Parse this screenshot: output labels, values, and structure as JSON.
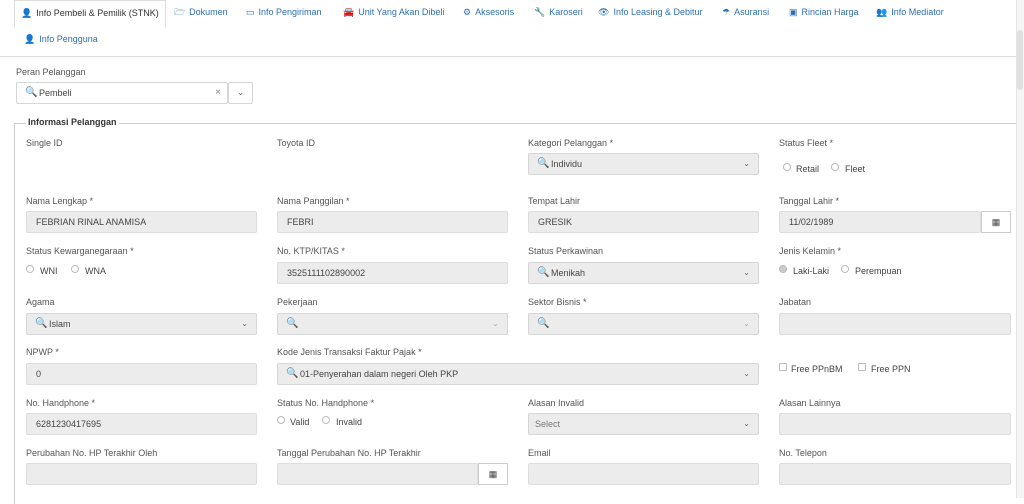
{
  "tabs": [
    {
      "label": "Info Pembeli & Pemilik (STNK)",
      "icon": "user-icon",
      "glyph": "👤"
    },
    {
      "label": "Dokumen",
      "icon": "folder-icon",
      "glyph": "🗁"
    },
    {
      "label": "Info Pengiriman",
      "icon": "map-icon",
      "glyph": "▭"
    },
    {
      "label": "Unit Yang Akan Dibeli",
      "icon": "car-icon",
      "glyph": "🚘"
    },
    {
      "label": "Aksesoris",
      "icon": "cogs-icon",
      "glyph": "⚙"
    },
    {
      "label": "Karoseri",
      "icon": "wrench-icon",
      "glyph": "🔧"
    },
    {
      "label": "Info Leasing & Debitur",
      "icon": "eye-icon",
      "glyph": "👁"
    },
    {
      "label": "Asuransi",
      "icon": "umbrella-icon",
      "glyph": "☂"
    },
    {
      "label": "Rincian Harga",
      "icon": "money-icon",
      "glyph": "▣"
    },
    {
      "label": "Info Mediator",
      "icon": "users-icon",
      "glyph": "👥"
    },
    {
      "label": "Info Pengguna",
      "icon": "user-icon",
      "glyph": "👤"
    }
  ],
  "peran": {
    "label": "Peran Pelanggan",
    "value": "Pembeli",
    "clear": "×",
    "chevron": "⌄"
  },
  "section_title": "Informasi Pelanggan",
  "fields": {
    "single_id": {
      "label": "Single ID"
    },
    "toyota_id": {
      "label": "Toyota ID"
    },
    "kategori": {
      "label": "Kategori Pelanggan *",
      "value": "Individu"
    },
    "status_fleet": {
      "label": "Status Fleet *",
      "opt1": "Retail",
      "opt2": "Fleet"
    },
    "nama_lengkap": {
      "label": "Nama Lengkap *",
      "value": "FEBRIAN RINAL ANAMISA"
    },
    "nama_panggilan": {
      "label": "Nama Panggilan *",
      "value": "FEBRI"
    },
    "tempat_lahir": {
      "label": "Tempat Lahir",
      "value": "GRESIK"
    },
    "tanggal_lahir": {
      "label": "Tanggal Lahir *",
      "value": "11/02/1989"
    },
    "kewarganegaraan": {
      "label": "Status Kewarganegaraan *",
      "opt1": "WNI",
      "opt2": "WNA"
    },
    "ktp": {
      "label": "No. KTP/KITAS *",
      "value": "3525111102890002"
    },
    "perkawinan": {
      "label": "Status Perkawinan",
      "value": "Menikah"
    },
    "jenis_kelamin": {
      "label": "Jenis Kelamin *",
      "opt1": "Laki-Laki",
      "opt2": "Perempuan"
    },
    "agama": {
      "label": "Agama",
      "value": "Islam"
    },
    "pekerjaan": {
      "label": "Pekerjaan",
      "value": ""
    },
    "sektor_bisnis": {
      "label": "Sektor Bisnis *",
      "value": ""
    },
    "jabatan": {
      "label": "Jabatan"
    },
    "npwp": {
      "label": "NPWP *",
      "value": "0"
    },
    "kode_faktur": {
      "label": "Kode Jenis Transaksi Faktur Pajak *",
      "value": "01-Penyerahan dalam negeri Oleh PKP"
    },
    "free_ppnbm": {
      "label": "Free PPnBM"
    },
    "free_ppn": {
      "label": "Free PPN"
    },
    "no_hp": {
      "label": "No. Handphone *",
      "value": "6281230417695"
    },
    "status_hp": {
      "label": "Status No. Handphone *",
      "opt1": "Valid",
      "opt2": "Invalid"
    },
    "alasan_invalid": {
      "label": "Alasan Invalid",
      "placeholder": "Select"
    },
    "alasan_lainnya": {
      "label": "Alasan Lainnya"
    },
    "perubahan_hp_oleh": {
      "label": "Perubahan No. HP Terakhir Oleh"
    },
    "tanggal_perubahan_hp": {
      "label": "Tanggal Perubahan No. HP Terakhir"
    },
    "email": {
      "label": "Email"
    },
    "no_telepon": {
      "label": "No. Telepon"
    }
  },
  "icons": {
    "search": "🔍",
    "chevron": "⌄",
    "calendar": "▦"
  }
}
